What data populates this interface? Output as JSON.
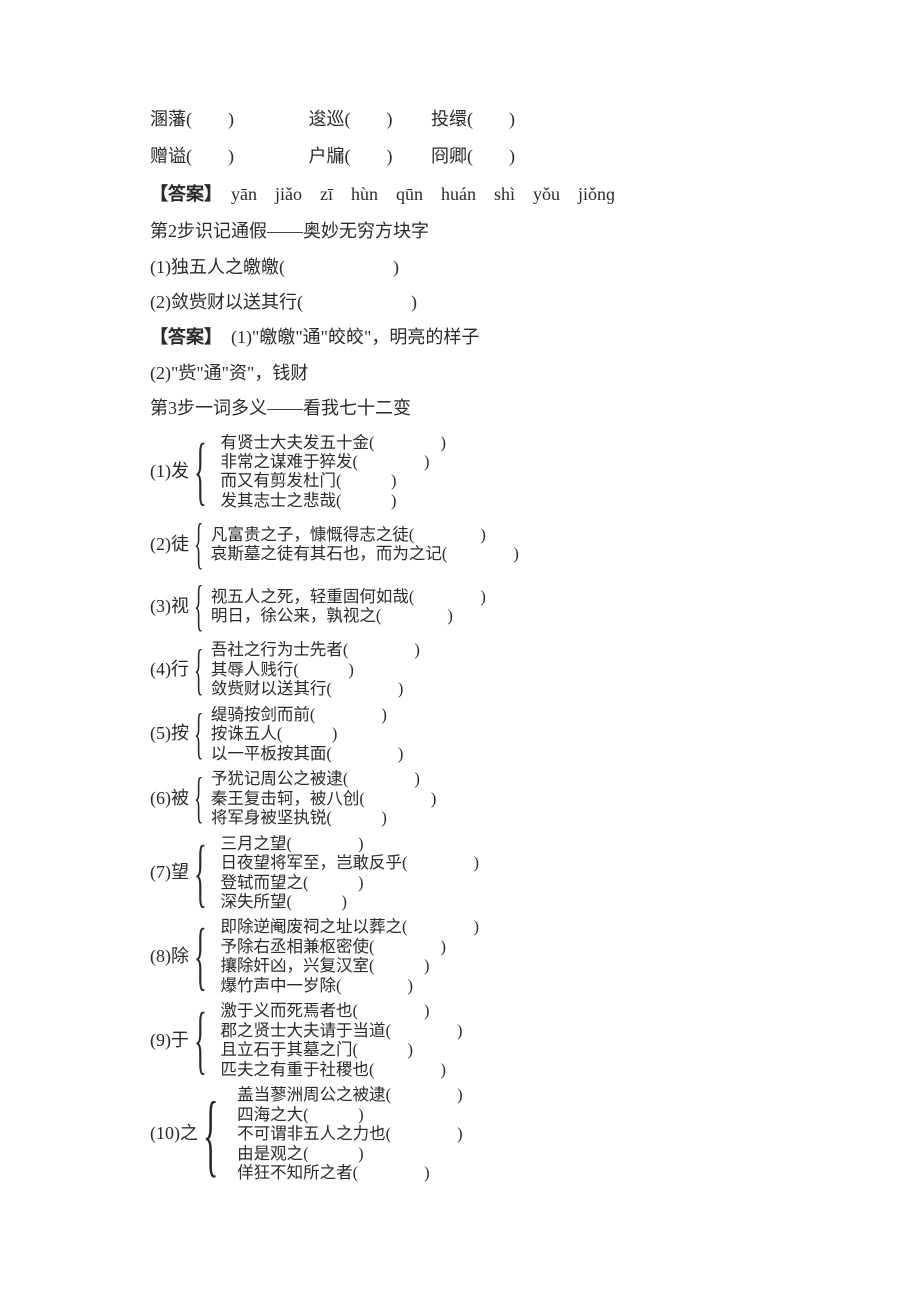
{
  "r1a": "溷藩(　　)",
  "r1b": "逡巡(　　)",
  "r1c": "投缳(　　)",
  "r2a": "赠谥(　　)",
  "r2b": "户牖(　　)",
  "r2c": "冏卿(　　)",
  "ans1_label": "【答案】",
  "ans1_text": "　yān　jiǎo　zī　hùn　qūn　huán　shì　yǒu　jiǒnɡ",
  "step2": "第2步识记通假——奥妙无穷方块字",
  "l_2_1": "(1)独五人之皦皦(　　　　　　)",
  "l_2_2": "(2)敛赀财以送其行(　　　　　　)",
  "ans2_label": "【答案】",
  "ans2_text": "　(1)\"皦皦\"通\"皎皎\"，明亮的样子",
  "l_2_3": "(2)\"赀\"通\"资\"，钱财",
  "step3": "第3步一词多义——看我七十二变",
  "e1_label": "(1)发",
  "e1": [
    "有贤士大夫发五十金(　　　　)",
    "非常之谋难于猝发(　　　　)",
    "而又有剪发杜门(　　　)",
    "发其志士之悲哉(　　　)"
  ],
  "e2_label": "(2)徒",
  "e2": [
    "凡富贵之子，慷慨得志之徒(　　　　)",
    "哀斯墓之徒有其石也，而为之记(　　　　)"
  ],
  "e3_label": "(3)视",
  "e3": [
    "视五人之死，轻重固何如哉(　　　　)",
    "明日，徐公来，孰视之(　　　　)"
  ],
  "e4_label": "(4)行",
  "e4": [
    "吾社之行为士先者(　　　　)",
    "其辱人贱行(　　　)",
    "敛赀财以送其行(　　　　)"
  ],
  "e5_label": "(5)按",
  "e5": [
    "缇骑按剑而前(　　　　)",
    "按诛五人(　　　)",
    "以一平板按其面(　　　　)"
  ],
  "e6_label": "(6)被",
  "e6": [
    "予犹记周公之被逮(　　　　)",
    "秦王复击轲，被八创(　　　　)",
    "将军身被坚执锐(　　　)"
  ],
  "e7_label": "(7)望",
  "e7": [
    "三月之望(　　　　)",
    "日夜望将军至，岂敢反乎(　　　　)",
    "登轼而望之(　　　)",
    "深失所望(　　　)"
  ],
  "e8_label": "(8)除",
  "e8": [
    "即除逆阉废祠之址以葬之(　　　　)",
    "予除右丞相兼枢密使(　　　　)",
    "攘除奸凶，兴复汉室(　　　)",
    "爆竹声中一岁除(　　　　)"
  ],
  "e9_label": "(9)于",
  "e9": [
    "激于义而死焉者也(　　　　)",
    "郡之贤士大夫请于当道(　　　　)",
    "且立石于其墓之门(　　　)",
    "匹夫之有重于社稷也(　　　　)"
  ],
  "e10_label": "(10)之",
  "e10": [
    "盖当蓼洲周公之被逮(　　　　)",
    "四海之大(　　　)",
    "不可谓非五人之力也(　　　　)",
    "由是观之(　　　)",
    "佯狂不知所之者(　　　　)"
  ]
}
